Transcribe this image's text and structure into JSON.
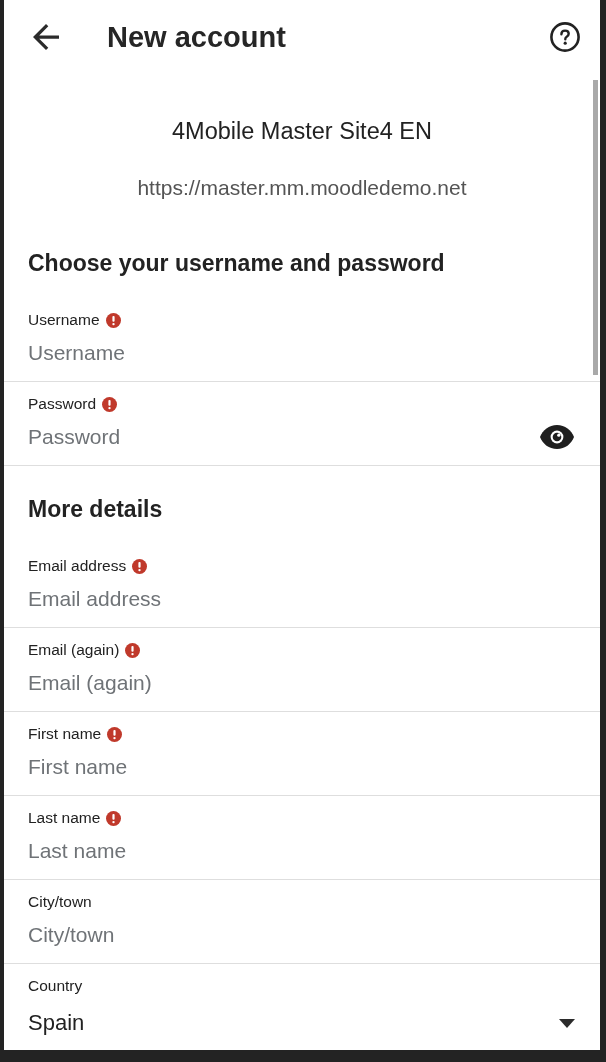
{
  "header": {
    "title": "New account"
  },
  "site": {
    "name": "4Mobile Master Site4 EN",
    "url": "https://master.mm.moodledemo.net"
  },
  "sections": [
    {
      "heading": "Choose your username and password",
      "fields": [
        {
          "kind": "text",
          "label": "Username",
          "required": true,
          "placeholder": "Username"
        },
        {
          "kind": "password",
          "label": "Password",
          "required": true,
          "placeholder": "Password"
        }
      ]
    },
    {
      "heading": "More details",
      "fields": [
        {
          "kind": "text",
          "label": "Email address",
          "required": true,
          "placeholder": "Email address"
        },
        {
          "kind": "text",
          "label": "Email (again)",
          "required": true,
          "placeholder": "Email (again)"
        },
        {
          "kind": "text",
          "label": "First name",
          "required": true,
          "placeholder": "First name"
        },
        {
          "kind": "text",
          "label": "Last name",
          "required": true,
          "placeholder": "Last name"
        },
        {
          "kind": "text",
          "label": "City/town",
          "required": false,
          "placeholder": "City/town"
        },
        {
          "kind": "select",
          "label": "Country",
          "required": false,
          "value": "Spain"
        }
      ]
    }
  ]
}
